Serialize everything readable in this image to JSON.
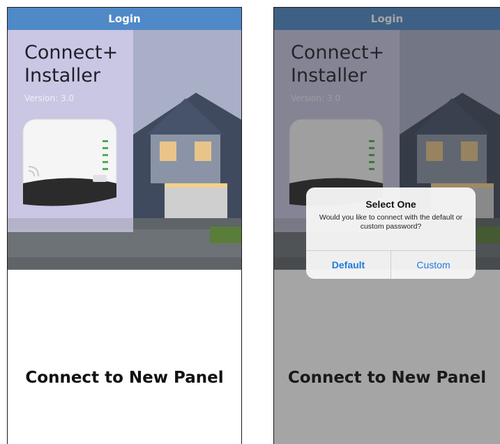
{
  "left_screen": {
    "nav_title": "Login",
    "app_title": "Connect+\nInstaller",
    "version": "Version: 3.0",
    "connect_button": "Connect to New Panel"
  },
  "right_screen": {
    "nav_title": "Login",
    "app_title": "Connect+\nInstaller",
    "version": "Version: 3.0",
    "connect_button": "Connect to New Panel",
    "dialog": {
      "title": "Select One",
      "message": "Would you like to connect with the default or custom password?",
      "default_label": "Default",
      "custom_label": "Custom"
    }
  },
  "colors": {
    "nav_bar": "#4f89c7",
    "dialog_button_text": "#1f7ae0",
    "device_led": "#4caf50"
  }
}
